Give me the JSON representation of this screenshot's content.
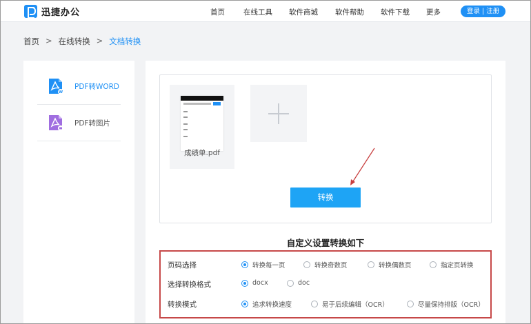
{
  "header": {
    "brand": "迅捷办公",
    "nav": [
      "首页",
      "在线工具",
      "软件商城",
      "软件帮助",
      "软件下载",
      "更多"
    ],
    "login": "登录 | 注册"
  },
  "breadcrumb": [
    "首页",
    ">",
    "在线转换",
    ">",
    "文档转换"
  ],
  "sidebar": {
    "items": [
      {
        "label": "PDF转WORD",
        "icon": "pdf-to-word-icon",
        "color": "#1f90f5",
        "active": true
      },
      {
        "label": "PDF转图片",
        "icon": "pdf-to-image-icon",
        "color": "#a06ee0",
        "active": false
      }
    ]
  },
  "upload": {
    "file_name": "成绩单.pdf",
    "convert": "转换"
  },
  "settings": {
    "title": "自定义设置转换如下",
    "page_select": {
      "label": "页码选择",
      "options": [
        "转换每一页",
        "转换奇数页",
        "转换偶数页",
        "指定页转换"
      ],
      "selected": "转换每一页"
    },
    "format": {
      "label": "选择转换格式",
      "options": [
        "docx",
        "doc"
      ],
      "selected": "docx"
    },
    "mode": {
      "label": "转换模式",
      "options": [
        "追求转换速度",
        "易于后续编辑（OCR）",
        "尽量保持排版（OCR）"
      ],
      "selected": "追求转换速度"
    }
  },
  "colors": {
    "accent": "#1f90f5",
    "highlight_border": "#c64848"
  }
}
